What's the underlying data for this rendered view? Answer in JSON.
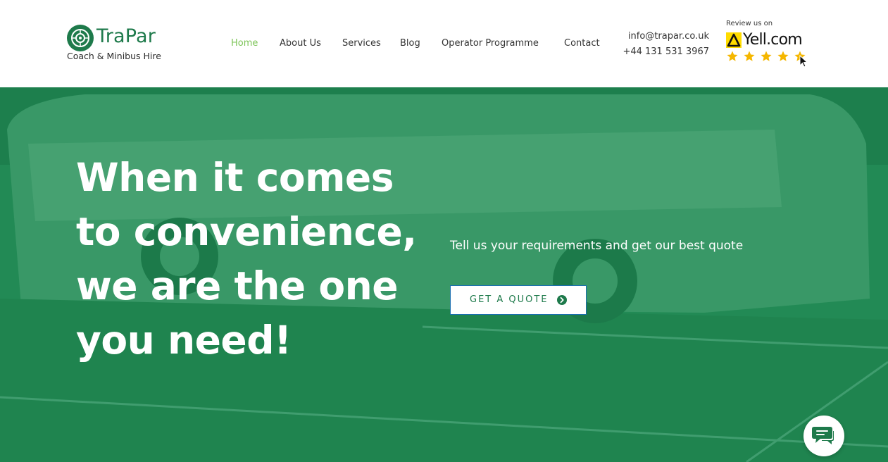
{
  "brand": {
    "name": "TraPar",
    "tagline": "Coach & Minibus Hire",
    "primary_color": "#1e7a4b",
    "accent_color": "#7cc457"
  },
  "nav": {
    "items": [
      {
        "label": "Home",
        "active": true
      },
      {
        "label": "About Us",
        "active": false
      },
      {
        "label": "Services",
        "active": false
      },
      {
        "label": "Blog",
        "active": false
      },
      {
        "label": "Operator Programme",
        "active": false
      },
      {
        "label": "Contact",
        "active": false
      }
    ]
  },
  "contact": {
    "email": "info@trapar.co.uk",
    "phone": "+44 131 531 3967"
  },
  "yell": {
    "review_text": "Review us on",
    "logo_text": "Yell.com",
    "rating": 5
  },
  "hero": {
    "title_lines": [
      "When it comes",
      "to convenience,",
      "we are the one",
      "you need!"
    ],
    "subtitle": "Tell us your requirements and get our best quote",
    "cta_label": "GET A QUOTE",
    "overlay_color": "#19844e"
  },
  "icons": {
    "logo": "wheel-icon",
    "yell": "yell-logo-icon",
    "cta": "chevron-circle-right-icon",
    "chat": "chat-icon",
    "cursor": "mouse-cursor-icon"
  }
}
